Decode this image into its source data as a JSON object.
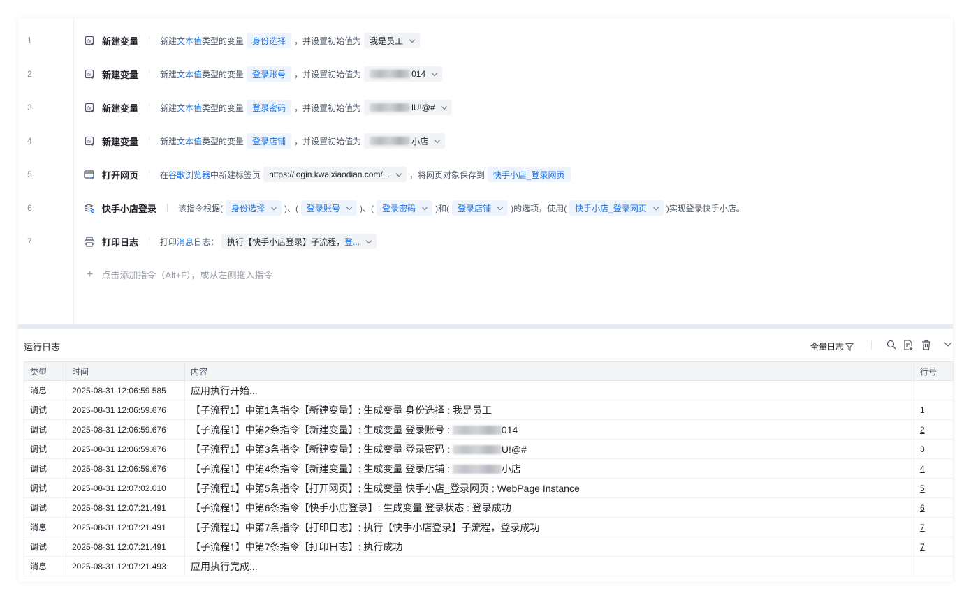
{
  "editor": {
    "rows": [
      {
        "n": "1",
        "name": "新建变量",
        "p1": "新建",
        "kw": "文本值",
        "p2": "类型的变量",
        "var": "身份选择",
        "p3": "，并设置初始值为",
        "value": "我是员工"
      },
      {
        "n": "2",
        "name": "新建变量",
        "p1": "新建",
        "kw": "文本值",
        "p2": "类型的变量",
        "var": "登录账号",
        "p3": "，并设置初始值为",
        "value": "014"
      },
      {
        "n": "3",
        "name": "新建变量",
        "p1": "新建",
        "kw": "文本值",
        "p2": "类型的变量",
        "var": "登录密码",
        "p3": "，并设置初始值为",
        "value": "lU!@#"
      },
      {
        "n": "4",
        "name": "新建变量",
        "p1": "新建",
        "kw": "文本值",
        "p2": "类型的变量",
        "var": "登录店铺",
        "p3": "，并设置初始值为",
        "value": "小店"
      }
    ],
    "row5": {
      "n": "5",
      "name": "打开网页",
      "p1": "在",
      "kw": "谷歌浏览器",
      "p2": "中新建标签页",
      "url": "https://login.kwaixiaodian.com/...",
      "p3": "，将网页对象保存到",
      "var": "快手小店_登录网页"
    },
    "row6": {
      "n": "6",
      "name": "快手小店登录",
      "p1": "该指令根据(",
      "c1": "身份选择",
      "s1": ")、(",
      "c2": "登录账号",
      "s2": ")、(",
      "c3": "登录密码",
      "s3": ")和(",
      "c4": "登录店铺",
      "s4": ")的选项，使用(",
      "c5": "快手小店_登录网页",
      "s5": ")实现登录快手小店。"
    },
    "row7": {
      "n": "7",
      "name": "打印日志",
      "p1": "打印",
      "kw": "消息",
      "p2": "日志：",
      "v1": "执行【快手小店登录】子流程，",
      "v2": "登..."
    },
    "add_hint": "点击添加指令（Alt+F），或从左侧拖入指令"
  },
  "log": {
    "title": "运行日志",
    "filter": "全量日志",
    "headers": {
      "type": "类型",
      "time": "时间",
      "content": "内容",
      "line": "行号"
    },
    "rows": [
      {
        "type": "消息",
        "time": "2025-08-31 12:06:59.585",
        "content": "应用执行开始...",
        "line": ""
      },
      {
        "type": "调试",
        "time": "2025-08-31 12:06:59.676",
        "content": "【子流程1】中第1条指令【新建变量】: 生成变量 身份选择 : 我是员工",
        "line": "1"
      },
      {
        "type": "调试",
        "time": "2025-08-31 12:06:59.676",
        "content": "【子流程1】中第2条指令【新建变量】: 生成变量 登录账号 : ",
        "tail": "014",
        "line": "2"
      },
      {
        "type": "调试",
        "time": "2025-08-31 12:06:59.676",
        "content": "【子流程1】中第3条指令【新建变量】: 生成变量 登录密码 : ",
        "tail": "U!@#",
        "line": "3"
      },
      {
        "type": "调试",
        "time": "2025-08-31 12:06:59.676",
        "content": "【子流程1】中第4条指令【新建变量】: 生成变量 登录店铺 : ",
        "tail": "小店",
        "line": "4"
      },
      {
        "type": "调试",
        "time": "2025-08-31 12:07:02.010",
        "content": "【子流程1】中第5条指令【打开网页】: 生成变量 快手小店_登录网页 : WebPage Instance",
        "line": "5"
      },
      {
        "type": "调试",
        "time": "2025-08-31 12:07:21.491",
        "content": "【子流程1】中第6条指令【快手小店登录】: 生成变量 登录状态 : 登录成功",
        "line": "6"
      },
      {
        "type": "消息",
        "time": "2025-08-31 12:07:21.491",
        "content": "【子流程1】中第7条指令【打印日志】: 执行【快手小店登录】子流程，登录成功",
        "line": "7"
      },
      {
        "type": "调试",
        "time": "2025-08-31 12:07:21.491",
        "content": "【子流程1】中第7条指令【打印日志】: 执行成功",
        "line": "7"
      },
      {
        "type": "消息",
        "time": "2025-08-31 12:07:21.493",
        "content": "应用执行完成...",
        "line": ""
      }
    ]
  }
}
